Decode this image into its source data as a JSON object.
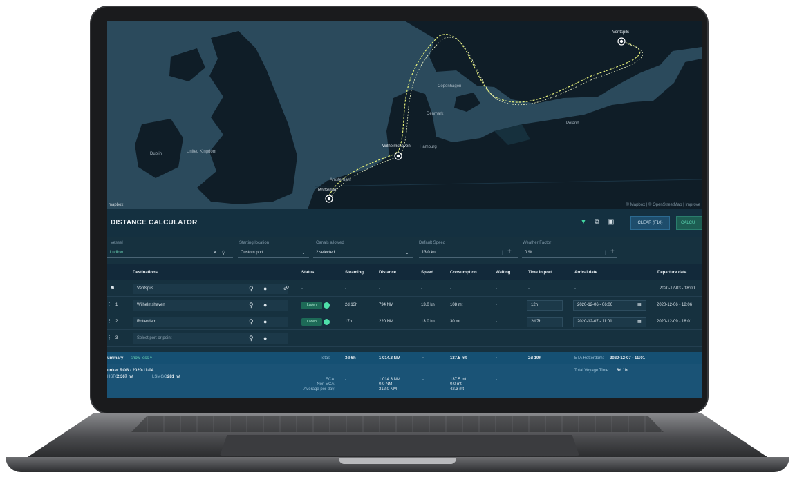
{
  "map": {
    "labels": [
      "Ventspils",
      "Wilhelmshaven",
      "Hamburg",
      "Rotterdam",
      "Copenhagen",
      "Amsterdam",
      "United Kingdom",
      "Dublin",
      "Denmark",
      "Poland"
    ],
    "attribution": "© Mapbox | © OpenStreetMap | Improve",
    "brand": "mapbox"
  },
  "panel": {
    "title": "DISTANCE CALCULATOR",
    "clear_label": "CLEAR (F10)",
    "calc_label": "CALCU",
    "fields": {
      "vessel_label": "Vessel",
      "vessel_value": "Ludlow",
      "start_label": "Starting location",
      "start_value": "Custom port",
      "canals_label": "Canals allowed",
      "canals_value": "2 selected",
      "speed_label": "Default Speed",
      "speed_value": "13.0 kn",
      "weather_label": "Weather Factor",
      "weather_value": "0 %"
    },
    "columns": {
      "destinations": "Destinations",
      "status": "Status",
      "steaming": "Steaming",
      "distance": "Distance",
      "speed": "Speed",
      "consumption": "Consumption",
      "waiting": "Waiting",
      "time_in_port": "Time in port",
      "arrival": "Arrival date",
      "departure": "Departure date"
    },
    "rows": [
      {
        "num": "",
        "port": "Ventspils",
        "status": "",
        "steaming": "-",
        "distance": "-",
        "speed": "-",
        "consumption": "-",
        "waiting": "-",
        "time_in_port": "-",
        "arrival": "-",
        "departure": "2020-12-03 - 18:00"
      },
      {
        "num": "1",
        "port": "Wilhelmshaven",
        "status": "Laden",
        "steaming": "2d 13h",
        "distance": "794 NM",
        "speed": "13.0 kn",
        "consumption": "108 mt",
        "waiting": "-",
        "time_in_port": "12h",
        "arrival": "2020-12-06 - 06:06",
        "departure": "2020-12-06 - 18:06"
      },
      {
        "num": "2",
        "port": "Rotterdam",
        "status": "Laden",
        "steaming": "17h",
        "distance": "220 NM",
        "speed": "13.0 kn",
        "consumption": "30 mt",
        "waiting": "-",
        "time_in_port": "2d 7h",
        "arrival": "2020-12-07 - 11:01",
        "departure": "2020-12-09 - 18:01"
      },
      {
        "num": "3",
        "port_placeholder": "Select port or point"
      }
    ],
    "summary": {
      "label": "ummary",
      "show_less": "show less ^",
      "total_label": "Total:",
      "steaming": "3d 6h",
      "distance": "1 014.3 NM",
      "speed": "-",
      "consumption": "137.5 mt",
      "waiting": "-",
      "time_in_port": "2d 19h",
      "eta_label": "ETA Rotterdam:",
      "eta_value": "2020-12-07 - 11:01",
      "bunker_title": "unker ROB - 2020-11-04",
      "hsfo_label": "HSFO:",
      "hsfo_value": "2 367 mt",
      "lsmgo_label": "LSMGO:",
      "lsmgo_value": "281 mt",
      "eca_label": "ECA:",
      "non_eca_label": "Non ECA:",
      "avg_label": "Average per day:",
      "eca_distance": "1 014.3 NM",
      "non_eca_distance": "0.0 NM",
      "avg_distance": "312.0 NM",
      "eca_consumption": "137.5 mt",
      "non_eca_consumption": "0.0 mt",
      "avg_consumption": "42.3 mt",
      "dash": "-",
      "total_voyage_label": "Total Voyage Time:",
      "total_voyage_value": "6d 1h"
    }
  },
  "colors": {
    "sea": "#2b4a5c",
    "land": "#0f1d27",
    "route": "#e6f07a",
    "accent_green": "#43d6a2",
    "summary_bg": "#1a5376"
  }
}
